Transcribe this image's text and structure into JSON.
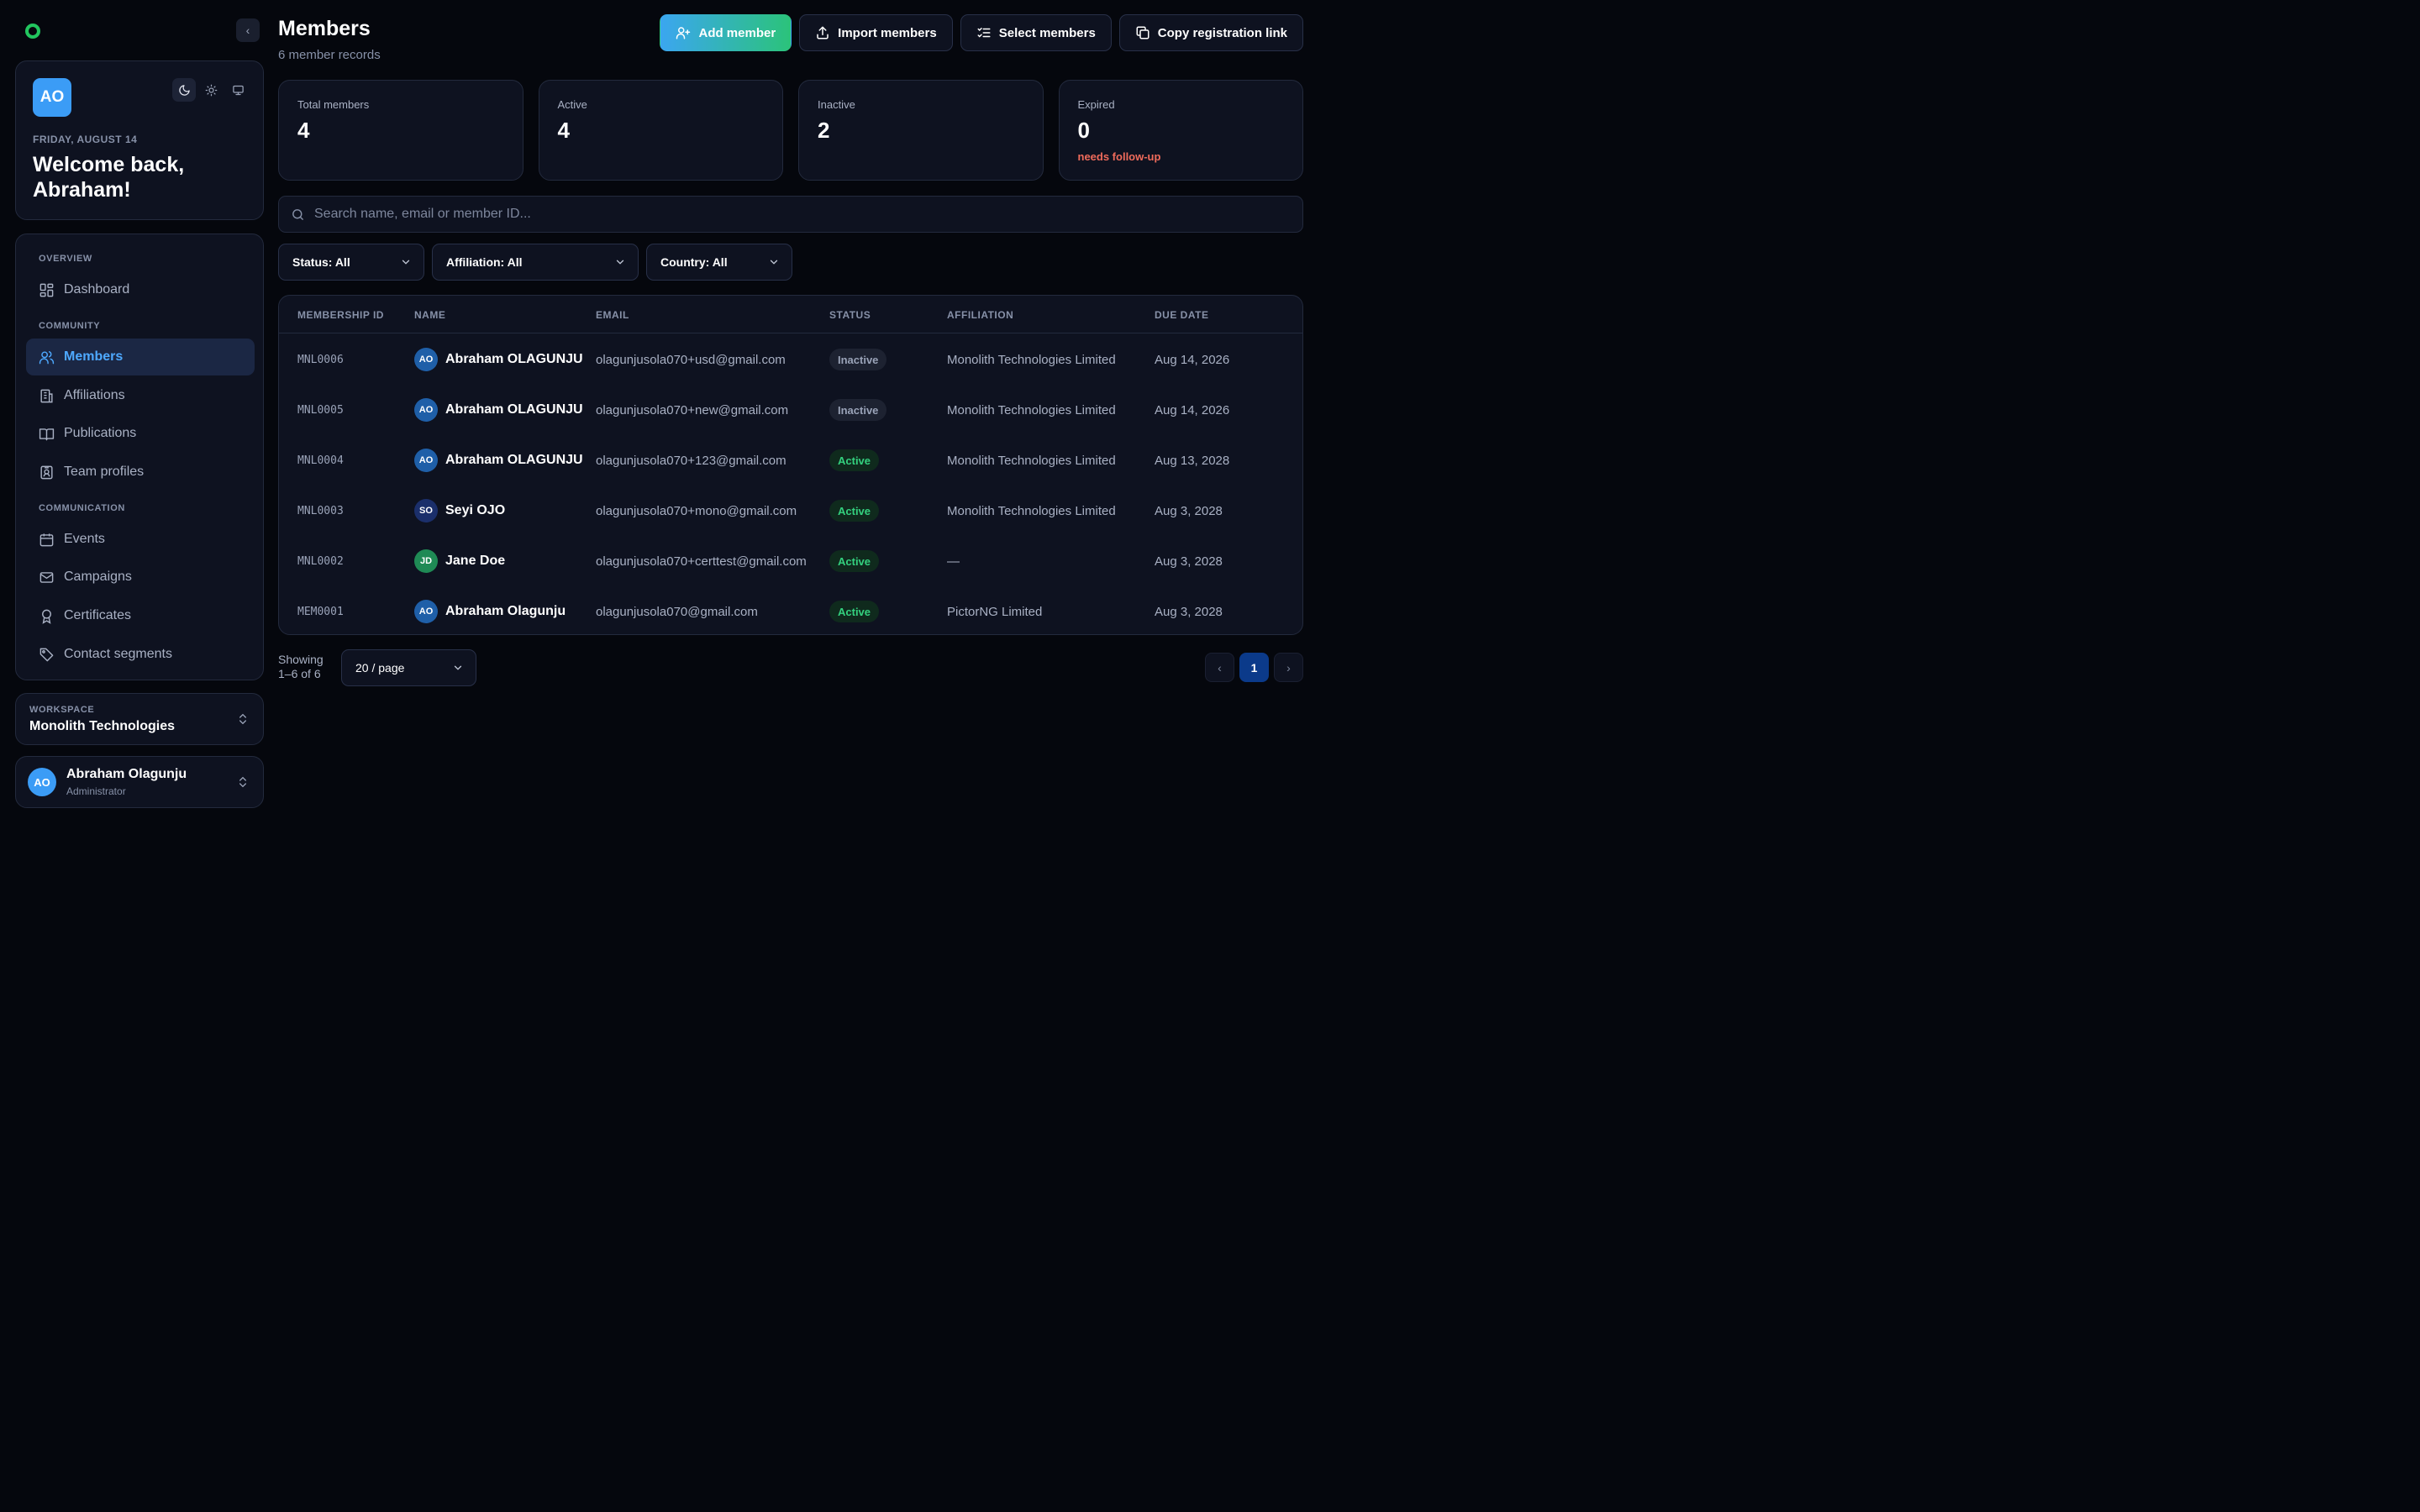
{
  "sidebar": {
    "collapse_glyph": "‹",
    "user_initials": "AO",
    "date": "FRIDAY, AUGUST 14",
    "welcome": "Welcome back, Abraham!",
    "sections": {
      "overview": "OVERVIEW",
      "community": "COMMUNITY",
      "communication": "COMMUNICATION"
    },
    "items": [
      {
        "label": "Dashboard",
        "icon": "dashboard-icon"
      },
      {
        "label": "Members",
        "icon": "users-icon",
        "active": true
      },
      {
        "label": "Affiliations",
        "icon": "building-icon"
      },
      {
        "label": "Publications",
        "icon": "book-icon"
      },
      {
        "label": "Team profiles",
        "icon": "id-badge-icon"
      },
      {
        "label": "Events",
        "icon": "calendar-icon"
      },
      {
        "label": "Campaigns",
        "icon": "mail-icon"
      },
      {
        "label": "Certificates",
        "icon": "award-icon"
      },
      {
        "label": "Contact segments",
        "icon": "tag-icon"
      }
    ],
    "workspace": {
      "label": "WORKSPACE",
      "name": "Monolith Technologies"
    },
    "user": {
      "initials": "AO",
      "name": "Abraham Olagunju",
      "role": "Administrator"
    }
  },
  "header": {
    "title": "Members",
    "subtitle": "6 member records",
    "actions": {
      "add": "Add member",
      "import": "Import members",
      "select": "Select members",
      "copy": "Copy registration link"
    }
  },
  "stats": [
    {
      "label": "Total members",
      "value": "4"
    },
    {
      "label": "Active",
      "value": "4"
    },
    {
      "label": "Inactive",
      "value": "2"
    },
    {
      "label": "Expired",
      "value": "0",
      "note": "needs follow-up"
    }
  ],
  "search": {
    "placeholder": "Search name, email or member ID..."
  },
  "filters": {
    "status": "Status: All",
    "affiliation": "Affiliation: All",
    "country": "Country: All"
  },
  "table": {
    "headers": [
      "MEMBERSHIP ID",
      "NAME",
      "EMAIL",
      "STATUS",
      "AFFILIATION",
      "DUE DATE"
    ],
    "rows": [
      {
        "id": "MNL0006",
        "initials": "AO",
        "name": "Abraham OLAGUNJU",
        "email": "olagunjusola070+usd@gmail.com",
        "status": "Inactive",
        "affiliation": "Monolith Technologies Limited",
        "due": "Aug 14, 2026",
        "avatar_color": "#1f5fa8"
      },
      {
        "id": "MNL0005",
        "initials": "AO",
        "name": "Abraham OLAGUNJU",
        "email": "olagunjusola070+new@gmail.com",
        "status": "Inactive",
        "affiliation": "Monolith Technologies Limited",
        "due": "Aug 14, 2026",
        "avatar_color": "#1f5fa8"
      },
      {
        "id": "MNL0004",
        "initials": "AO",
        "name": "Abraham OLAGUNJU",
        "email": "olagunjusola070+123@gmail.com",
        "status": "Active",
        "affiliation": "Monolith Technologies Limited",
        "due": "Aug 13, 2028",
        "avatar_color": "#1f5fa8"
      },
      {
        "id": "MNL0003",
        "initials": "SO",
        "name": "Seyi OJO",
        "email": "olagunjusola070+mono@gmail.com",
        "status": "Active",
        "affiliation": "Monolith Technologies Limited",
        "due": "Aug 3, 2028",
        "avatar_color": "#1b2f6b"
      },
      {
        "id": "MNL0002",
        "initials": "JD",
        "name": "Jane Doe",
        "email": "olagunjusola070+certtest@gmail.com",
        "status": "Active",
        "affiliation": "—",
        "due": "Aug 3, 2028",
        "avatar_color": "#1f8a55"
      },
      {
        "id": "MEM0001",
        "initials": "AO",
        "name": "Abraham Olagunju",
        "email": "olagunjusola070@gmail.com",
        "status": "Active",
        "affiliation": "PictorNG Limited",
        "due": "Aug 3, 2028",
        "avatar_color": "#1f5fa8"
      }
    ]
  },
  "pagination": {
    "showing_label": "Showing",
    "range": "1–6 of 6",
    "page_size": "20 / page",
    "current_page": "1",
    "prev_glyph": "‹",
    "next_glyph": "›"
  },
  "colors": {
    "accent": "#4ea9ff",
    "active": "#34d17f",
    "warning": "#ef6b5b",
    "logo": "#22c55e"
  }
}
